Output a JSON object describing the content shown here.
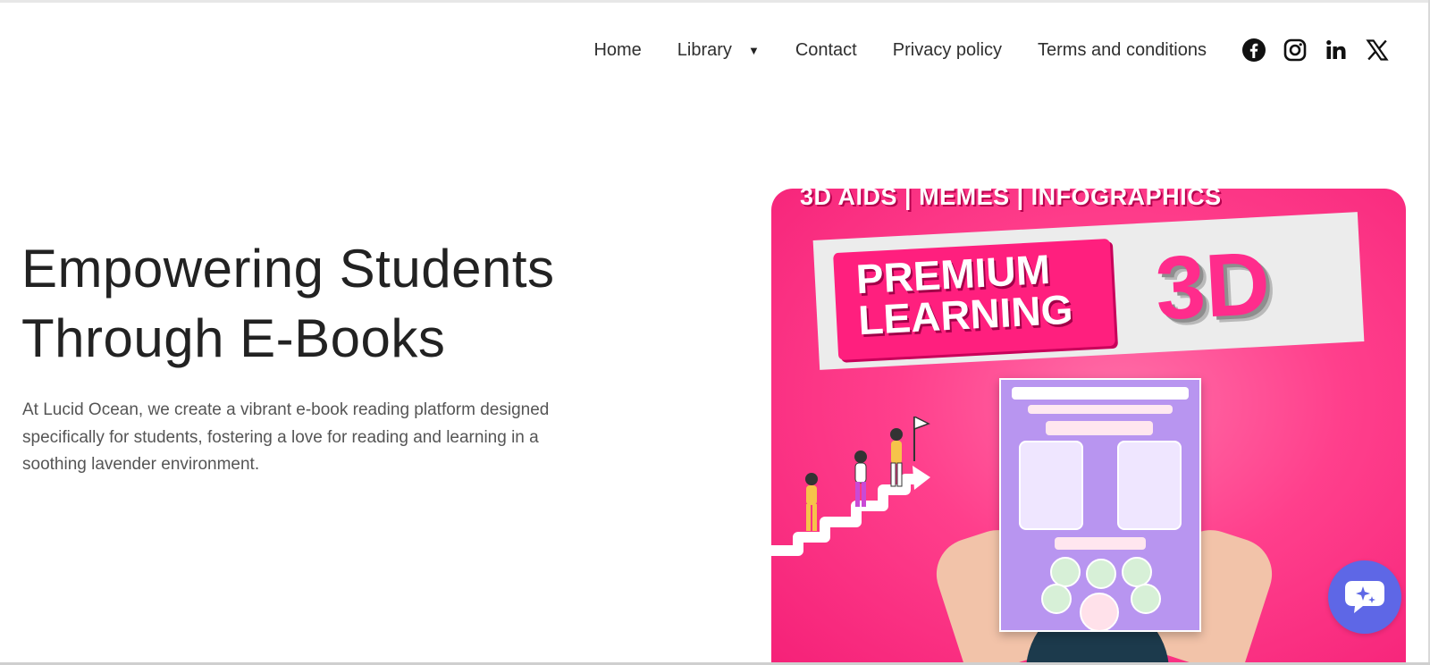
{
  "nav": {
    "links": [
      {
        "label": "Home"
      },
      {
        "label": "Library"
      },
      {
        "label": "Contact"
      },
      {
        "label": "Privacy policy"
      },
      {
        "label": "Terms and conditions"
      }
    ],
    "library_caret": "▼",
    "social_icons": [
      "facebook-icon",
      "instagram-icon",
      "linkedin-icon",
      "x-icon"
    ]
  },
  "hero": {
    "title_line1": "Empowering Students",
    "title_line2": "Through E-Books",
    "description": "At Lucid Ocean, we create a vibrant e-book reading platform designed specifically for students, fostering a love for reading and learning in a soothing lavender environment."
  },
  "hero_image": {
    "top_banner": "3D AIDS | MEMES | INFOGRAPHICS",
    "premium_line1": "PREMIUM",
    "premium_line2": "LEARNING",
    "three_d": "3D",
    "background_color": "#ff3f8c"
  },
  "chat": {
    "icon": "ai-chat-icon",
    "color": "#5e67e6"
  }
}
